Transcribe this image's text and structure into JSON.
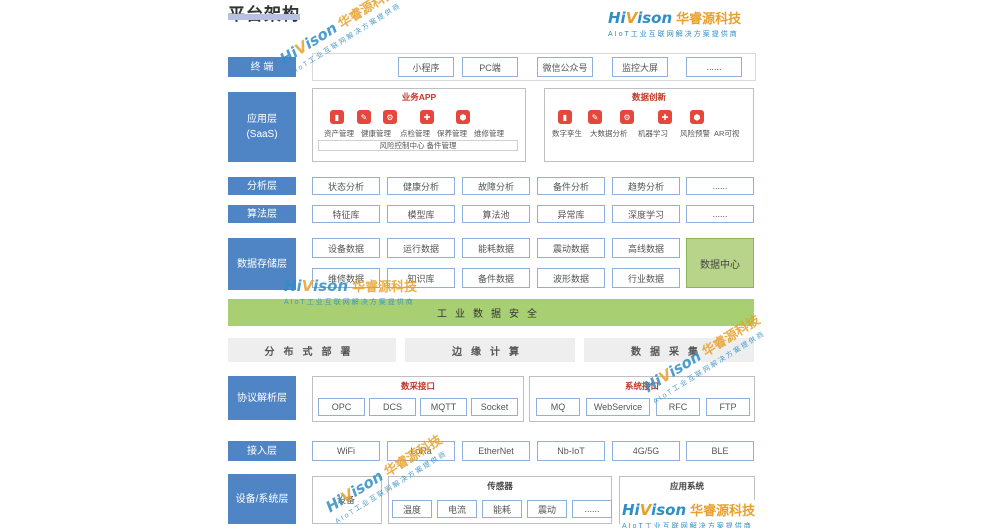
{
  "page_title": "平台架构",
  "brand": {
    "en_a": "Hi",
    "en_b": "V",
    "en_c": "ison",
    "cn": "华睿源科技",
    "sub": "AIoT工业互联网解决方案提供商"
  },
  "layers": {
    "terminal": {
      "label": "终  端",
      "items": [
        "小程序",
        "PC端",
        "微信公众号",
        "监控大屏",
        "......"
      ]
    },
    "app": {
      "label": "应用层\n(SaaS)",
      "business_title": "业务APP",
      "business_icons": [
        "资产管理",
        "健康管理",
        "点检管理",
        "保养管理",
        "维修管理"
      ],
      "business_footer": "风险控制中心  备件管理",
      "data_title": "数据创新",
      "data_icons": [
        "数字孪生",
        "大数据分析",
        "机器学习",
        "风险预警",
        "AR可视"
      ]
    },
    "analysis": {
      "label": "分析层",
      "items": [
        "状态分析",
        "健康分析",
        "故障分析",
        "备件分析",
        "趋势分析",
        "......"
      ]
    },
    "algorithm": {
      "label": "算法层",
      "items": [
        "特征库",
        "模型库",
        "算法池",
        "异常库",
        "深度学习",
        "......"
      ]
    },
    "storage": {
      "label": "数据存储层",
      "row1": [
        "设备数据",
        "运行数据",
        "能耗数据",
        "震动数据",
        "高线数据"
      ],
      "row2": [
        "维修数据",
        "知识库",
        "备件数据",
        "波形数据",
        "行业数据"
      ],
      "center": "数据中心"
    },
    "security": "工业数据安全",
    "compute": [
      "分布式部署",
      "边缘计算",
      "数据采集"
    ],
    "protocol": {
      "label": "协议解析层",
      "left_title": "数采接口",
      "left_items": [
        "OPC",
        "DCS",
        "MQTT",
        "Socket"
      ],
      "right_title": "系统接口",
      "right_items": [
        "MQ",
        "WebService",
        "RFC",
        "FTP"
      ]
    },
    "access": {
      "label": "接入层",
      "items": [
        "WiFi",
        "LoRa",
        "EtherNet",
        "Nb-IoT",
        "4G/5G",
        "BLE"
      ]
    },
    "device": {
      "label": "设备/系统层",
      "left_item": "设备",
      "sensor_title": "传感器",
      "sensor_items": [
        "温度",
        "电流",
        "能耗",
        "震动",
        "......"
      ],
      "app_sys_title": "应用系统"
    }
  }
}
